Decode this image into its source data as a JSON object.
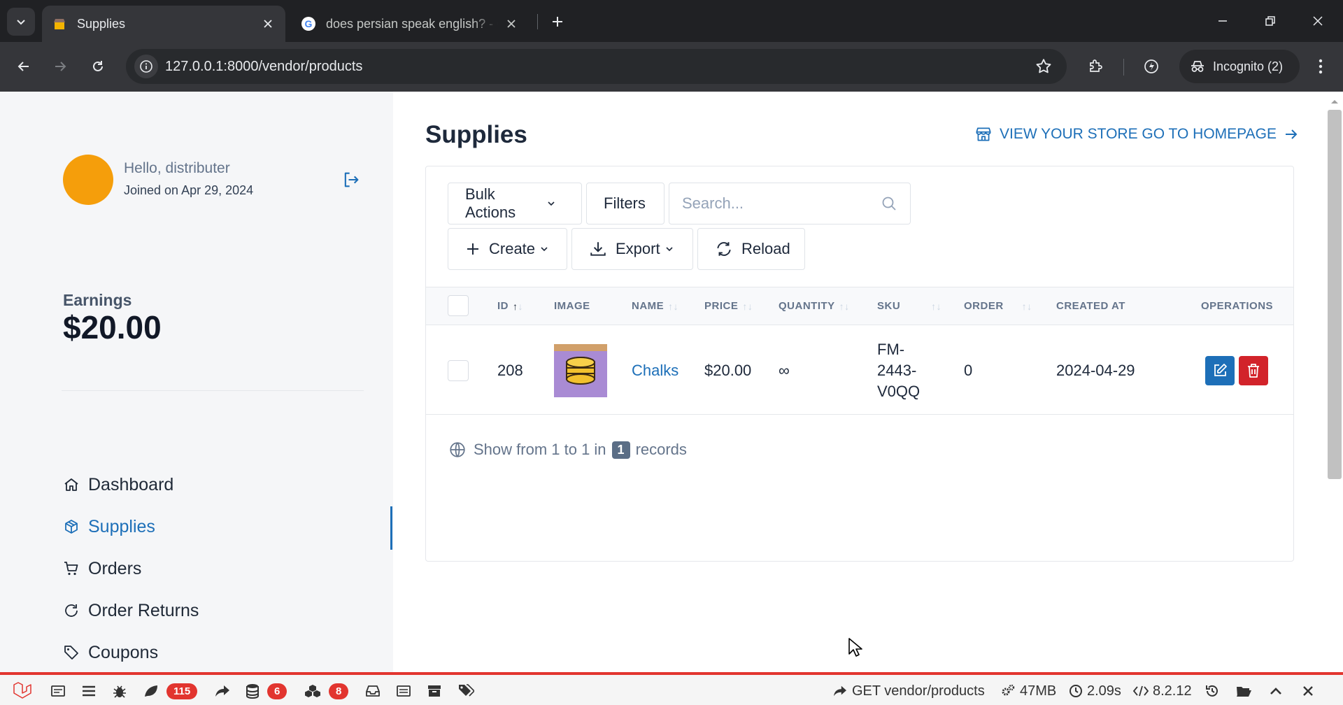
{
  "browser": {
    "tabs": [
      {
        "title": "Supplies",
        "active": true
      },
      {
        "title": "does persian speak english? - G",
        "active": false
      }
    ],
    "url": "127.0.0.1:8000/vendor/products",
    "profile_label": "Incognito (2)"
  },
  "sidebar": {
    "greeting": "Hello, distributer",
    "joined": "Joined on Apr 29, 2024",
    "earnings_label": "Earnings",
    "earnings_value": "$20.00",
    "nav": [
      {
        "label": "Dashboard",
        "icon": "home-icon"
      },
      {
        "label": "Supplies",
        "icon": "box-icon",
        "active": true
      },
      {
        "label": "Orders",
        "icon": "cart-icon"
      },
      {
        "label": "Order Returns",
        "icon": "refresh-icon"
      },
      {
        "label": "Coupons",
        "icon": "tag-icon"
      }
    ]
  },
  "main": {
    "title": "Supplies",
    "store_link": "VIEW YOUR STORE GO TO HOMEPAGE",
    "toolbar": {
      "bulk_actions": "Bulk Actions",
      "filters": "Filters",
      "search_placeholder": "Search...",
      "create": "Create",
      "export": "Export",
      "reload": "Reload"
    },
    "columns": [
      "ID",
      "IMAGE",
      "NAME",
      "PRICE",
      "QUANTITY",
      "SKU",
      "ORDER",
      "CREATED AT",
      "OPERATIONS"
    ],
    "rows": [
      {
        "id": "208",
        "name": "Chalks",
        "price": "$20.00",
        "quantity": "∞",
        "sku_lines": [
          "FM-",
          "2443-",
          "V0QQ"
        ],
        "order": "0",
        "created_at": "2024-04-29"
      }
    ],
    "footer": {
      "prefix": "Show from 1 to 1 in",
      "count": "1",
      "suffix": "records"
    }
  },
  "debugbar": {
    "queries_count": "115",
    "models_count": "6",
    "views_count": "8",
    "route": "GET vendor/products",
    "memory": "47MB",
    "time": "2.09s",
    "php_version": "8.2.12"
  },
  "colors": {
    "accent": "#1d6fb8",
    "avatar": "#f59e0b",
    "edit_button": "#1d6fb8",
    "delete_button": "#d2232a",
    "debugbar_accent": "#e2352f"
  }
}
